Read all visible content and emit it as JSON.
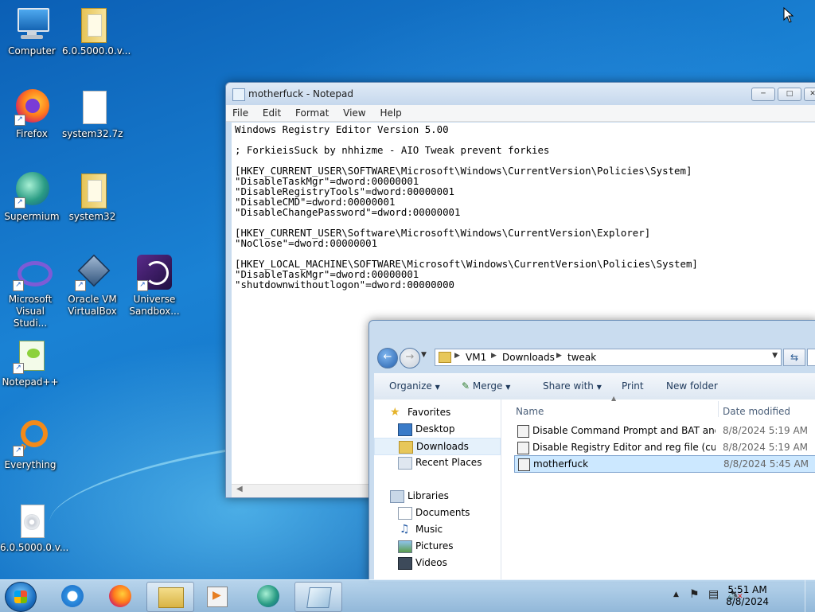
{
  "desktop": {
    "icons": [
      {
        "label": "Computer"
      },
      {
        "label": "6.0.5000.0.v..."
      },
      {
        "label": "Firefox"
      },
      {
        "label": "system32.7z"
      },
      {
        "label": "Supermium"
      },
      {
        "label": "system32"
      },
      {
        "label": "Microsoft Visual Studi..."
      },
      {
        "label": "Oracle VM VirtualBox"
      },
      {
        "label": "Universe Sandbox..."
      },
      {
        "label": "Notepad++"
      },
      {
        "label": "Everything"
      },
      {
        "label": "6.0.5000.0.v..."
      }
    ]
  },
  "notepad": {
    "title": "motherfuck - Notepad",
    "menu": [
      "File",
      "Edit",
      "Format",
      "View",
      "Help"
    ],
    "content": "Windows Registry Editor Version 5.00\n\n; ForkieisSuck by nhhizme - AIO Tweak prevent forkies\n\n[HKEY_CURRENT_USER\\SOFTWARE\\Microsoft\\Windows\\CurrentVersion\\Policies\\System]\n\"DisableTaskMgr\"=dword:00000001\n\"DisableRegistryTools\"=dword:00000001\n\"DisableCMD\"=dword:00000001\n\"DisableChangePassword\"=dword:00000001\n\n[HKEY_CURRENT_USER\\Software\\Microsoft\\Windows\\CurrentVersion\\Explorer]\n\"NoClose\"=dword:00000001\n\n[HKEY_LOCAL_MACHINE\\SOFTWARE\\Microsoft\\Windows\\CurrentVersion\\Policies\\System]\n\"DisableTaskMgr\"=dword:00000001\n\"shutdownwithoutlogon\"=dword:00000000"
  },
  "explorer": {
    "breadcrumb": [
      "VM1",
      "Downloads",
      "tweak"
    ],
    "toolbar": {
      "organize": "Organize",
      "merge": "Merge",
      "share_with": "Share with",
      "print": "Print",
      "new_folder": "New folder"
    },
    "columns": {
      "name": "Name",
      "date_modified": "Date modified"
    },
    "nav": {
      "favorites_header": "Favorites",
      "favorites": [
        "Desktop",
        "Downloads",
        "Recent Places"
      ],
      "libraries_header": "Libraries",
      "libraries": [
        "Documents",
        "Music",
        "Pictures",
        "Videos"
      ]
    },
    "files": [
      {
        "name": "Disable Command Prompt and BAT and ...",
        "date": "8/8/2024 5:19 AM"
      },
      {
        "name": "Disable Registry Editor and reg file (curre...",
        "date": "8/8/2024 5:19 AM"
      },
      {
        "name": "motherfuck",
        "date": "8/8/2024 5:45 AM"
      }
    ]
  },
  "taskbar": {
    "clock_time": "5:51 AM",
    "clock_date": "8/8/2024"
  },
  "colors": {
    "desktop": "#1473c6",
    "selection": "#cce8ff",
    "taskbar": "#a9c8e3"
  }
}
